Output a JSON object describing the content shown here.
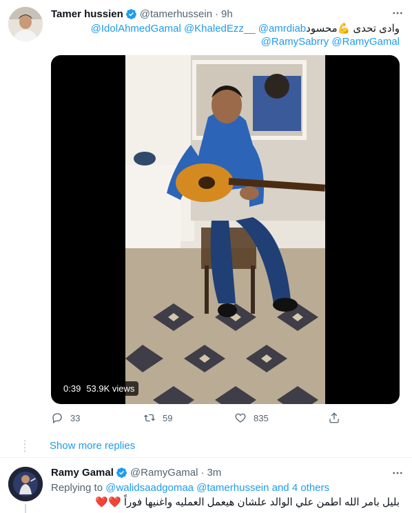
{
  "tweet": {
    "author_name": "Tamer hussien",
    "author_handle": "@tamerhussein",
    "dot": "·",
    "time": "9h",
    "more_icon": "more-icon",
    "line1_text": "وادى تحدى 💪محسود",
    "line1_mentions": "@IdolAhmedGamal @KhaledEzz__ @amrdiab",
    "line2_mentions": "@RamySabrry @RamyGamal",
    "video_time": "0:39",
    "video_views": "53.9K views",
    "replies": "33",
    "retweets": "59",
    "likes": "835"
  },
  "show_more": {
    "label": "Show more replies"
  },
  "reply": {
    "author_name": "Ramy Gamal",
    "author_handle": "@RamyGamal",
    "dot": "·",
    "time": "3m",
    "replying_prefix": "Replying to",
    "replying_targets": "@walidsaadgomaa @tamerhussein and 4 others",
    "text": "بليل بامر الله اطمن علي الوالد علشان هيعمل العمليه واغنيها فوراً ❤️❤️"
  },
  "colors": {
    "link": "#1d9bf0",
    "secondary": "#536471",
    "verified": "#1d9bf0"
  }
}
